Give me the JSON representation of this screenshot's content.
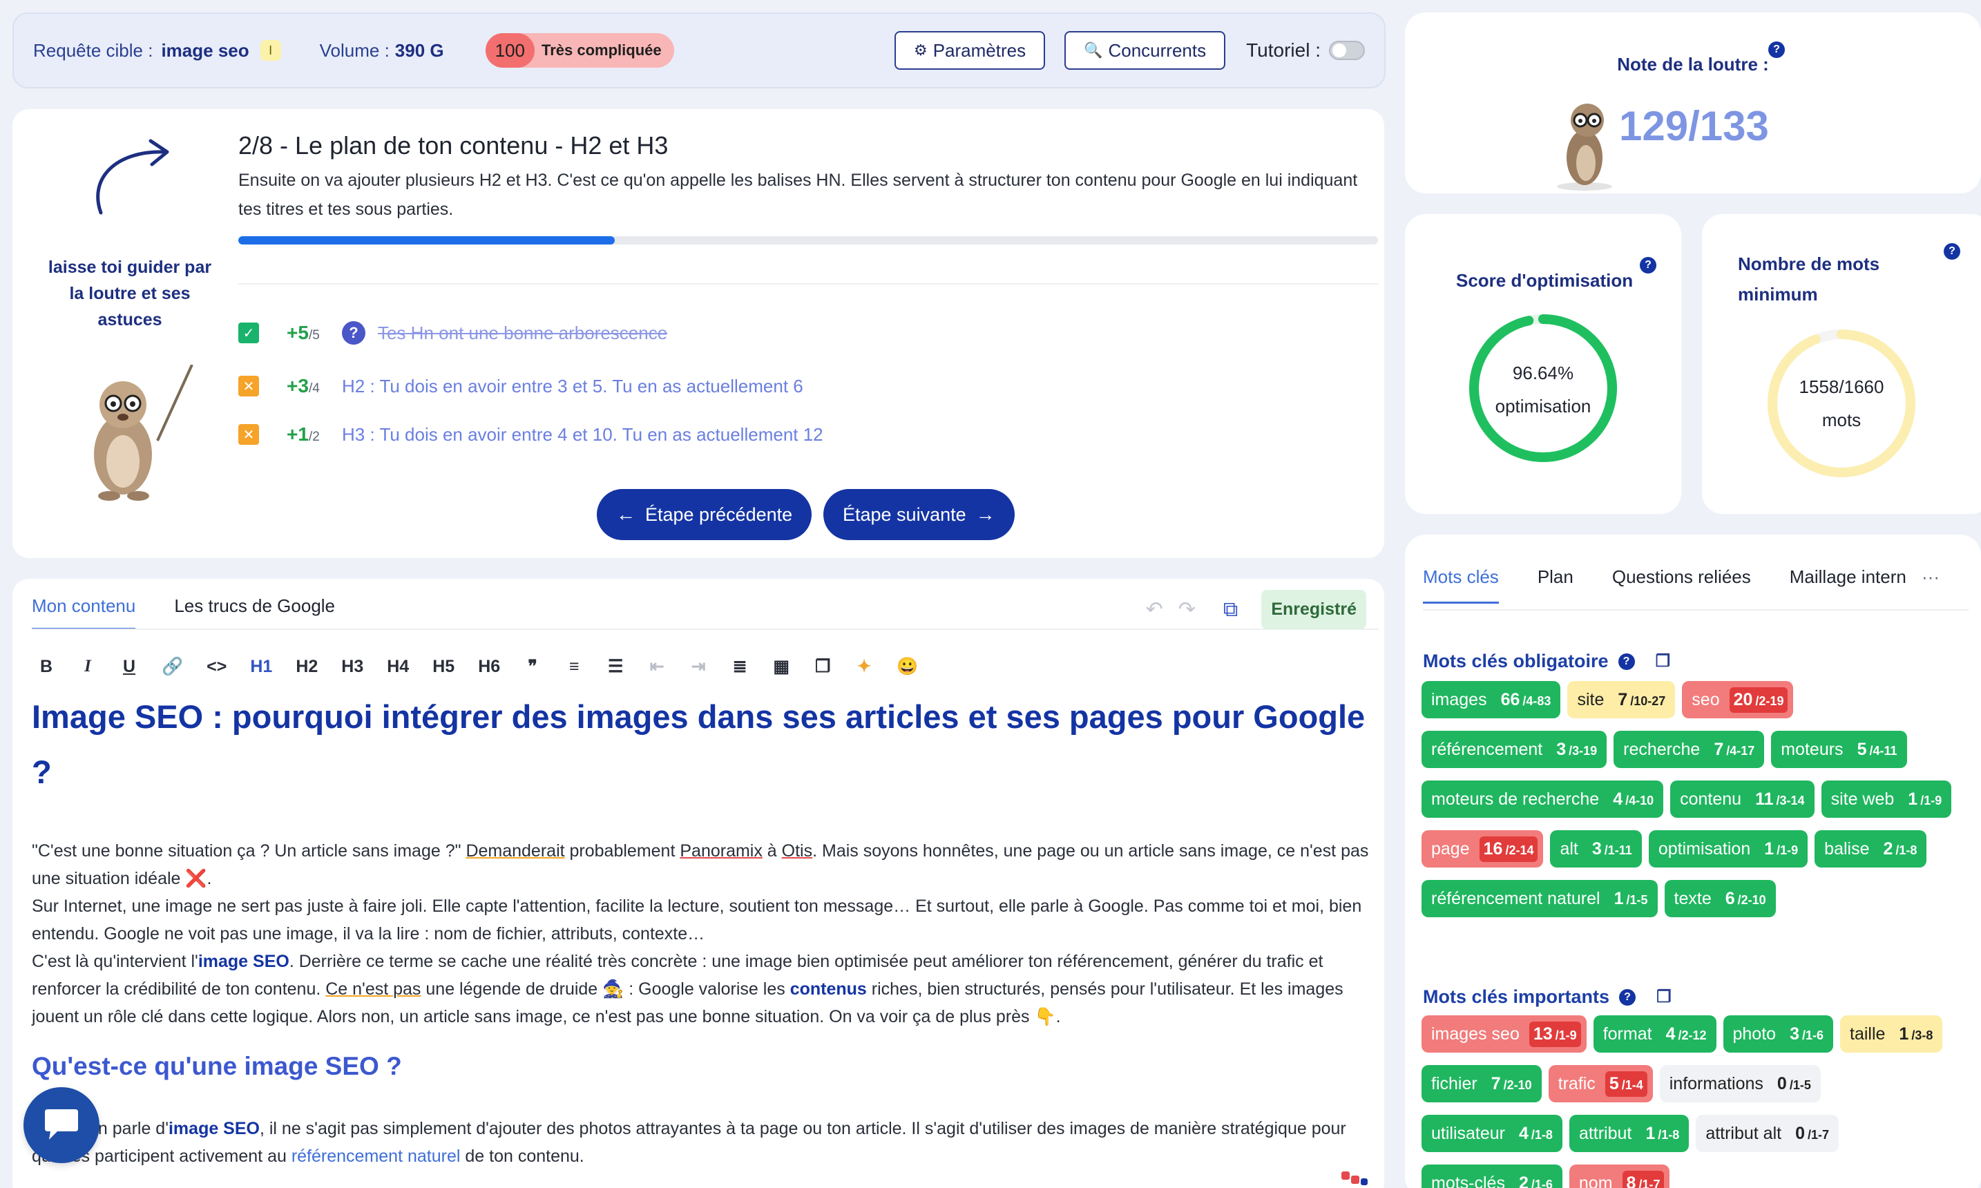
{
  "topbar": {
    "query_label": "Requête cible :",
    "query_value": "image seo",
    "info_icon": "I",
    "volume_label": "Volume :",
    "volume_value": "390 G",
    "difficulty_score": "100",
    "difficulty_label": "Très compliquée",
    "settings_label": "Paramètres",
    "competitors_label": "Concurrents",
    "tutorial_label": "Tutoriel :",
    "tutorial_on": false
  },
  "step": {
    "help_text": "laisse toi guider par la loutre et ses astuces",
    "title": "2/8 - Le plan de ton contenu - H2 et H3",
    "description": "Ensuite on va ajouter plusieurs H2 et H3. C'est ce qu'on appelle les balises HN. Elles servent à structurer ton contenu pour Google en lui indiquant tes titres et tes sous parties.",
    "progress": 0.33,
    "tasks": [
      {
        "points": "+5",
        "max": "/5",
        "text": "Tes Hn ont une bonne arborescence",
        "done": true
      },
      {
        "points": "+3",
        "max": "/4",
        "text": "H2 : Tu dois en avoir entre 3 et 5. Tu en as actuellement 6",
        "done": false
      },
      {
        "points": "+1",
        "max": "/2",
        "text": "H3 : Tu dois en avoir entre 4 et 10. Tu en as actuellement 12",
        "done": false
      }
    ],
    "prev_label": "Étape précédente",
    "next_label": "Étape suivante"
  },
  "editor": {
    "tab_content": "Mon contenu",
    "tab_google": "Les trucs de Google",
    "saved_label": "Enregistré",
    "tools": [
      "B",
      "I",
      "U",
      "🔗",
      "<>",
      "H1",
      "H2",
      "H3",
      "H4",
      "H5",
      "H6",
      "❞",
      "≡",
      "☰",
      "⇤",
      "⇥",
      "≣",
      "▦",
      "❐",
      "✦",
      "😀"
    ],
    "h1": "Image SEO : pourquoi intégrer des images dans ses articles et ses pages pour Google ?",
    "p1_a": "\"C'est une bonne situation ça ? Un article sans image ?\" ",
    "p1_b": "Demanderait",
    "p1_c": " probablement ",
    "p1_d": "Panoramix",
    "p1_e": " à ",
    "p1_f": "Otis",
    "p1_g": ". Mais soyons honnêtes, une page ou un article sans image, ce n'est pas une situation idéale ❌.",
    "p2": "Sur Internet, une image ne sert pas juste à faire joli. Elle capte l'attention, facilite la lecture, soutient ton message… Et surtout, elle parle à Google. Pas comme toi et moi, bien entendu. Google ne voit pas une image, il va la lire : nom de fichier, attributs, contexte…",
    "p3_a": "C'est là qu'intervient l'",
    "p3_b": "image SEO",
    "p3_c": ". Derrière ce terme se cache une réalité très concrète : une image bien optimisée peut améliorer ton référencement, générer du trafic et renforcer la crédibilité de ton contenu. ",
    "p3_d": "Ce n'est pas",
    "p3_e": " une légende de druide 🧙 : Google valorise les ",
    "p3_f": "contenus",
    "p3_g": " riches, bien structurés, pensés pour l'utilisateur. Et les images jouent un rôle clé dans cette logique. Alors non, un article sans image, ce n'est pas une bonne situation. On va voir ça de plus près 👇.",
    "h2": "Qu'est-ce qu'une image SEO ?",
    "p4_a": "Quand on parle d'",
    "p4_b": "image SEO",
    "p4_c": ", il ne s'agit pas simplement d'ajouter des photos attrayantes à ta page ou ton article. Il s'agit d'utiliser des images de manière stratégique pour qu'elles participent activement au ",
    "p4_d": "référencement naturel",
    "p4_e": " de ton contenu."
  },
  "scores": {
    "note_title": "Note de la loutre :",
    "note_value": "129/133",
    "optim_title": "Score d'optimisation",
    "optim_percent": "96.64%",
    "optim_unit": "optimisation",
    "optim_fraction": 0.9664,
    "words_title": "Nombre de mots minimum",
    "words_value": "1558/1660",
    "words_unit": "mots",
    "words_fraction": 0.9386
  },
  "keywords": {
    "tabs": [
      "Mots clés",
      "Plan",
      "Questions reliées",
      "Maillage intern"
    ],
    "more": "···",
    "mandatory_title": "Mots clés obligatoire",
    "important_title": "Mots clés importants",
    "mandatory": [
      {
        "w": "images",
        "c": "66",
        "r": "/4-83",
        "s": "g"
      },
      {
        "w": "site",
        "c": "7",
        "r": "/10-27",
        "s": "y"
      },
      {
        "w": "seo",
        "c": "20",
        "r": "/2-19",
        "s": "r"
      },
      {
        "w": "référencement",
        "c": "3",
        "r": "/3-19",
        "s": "g"
      },
      {
        "w": "recherche",
        "c": "7",
        "r": "/4-17",
        "s": "g"
      },
      {
        "w": "moteurs",
        "c": "5",
        "r": "/4-11",
        "s": "g"
      },
      {
        "w": "moteurs de recherche",
        "c": "4",
        "r": "/4-10",
        "s": "g"
      },
      {
        "w": "contenu",
        "c": "11",
        "r": "/3-14",
        "s": "g"
      },
      {
        "w": "site web",
        "c": "1",
        "r": "/1-9",
        "s": "g"
      },
      {
        "w": "page",
        "c": "16",
        "r": "/2-14",
        "s": "r"
      },
      {
        "w": "alt",
        "c": "3",
        "r": "/1-11",
        "s": "g"
      },
      {
        "w": "optimisation",
        "c": "1",
        "r": "/1-9",
        "s": "g"
      },
      {
        "w": "balise",
        "c": "2",
        "r": "/1-8",
        "s": "g"
      },
      {
        "w": "référencement naturel",
        "c": "1",
        "r": "/1-5",
        "s": "g"
      },
      {
        "w": "texte",
        "c": "6",
        "r": "/2-10",
        "s": "g"
      }
    ],
    "important": [
      {
        "w": "images seo",
        "c": "13",
        "r": "/1-9",
        "s": "r"
      },
      {
        "w": "format",
        "c": "4",
        "r": "/2-12",
        "s": "g"
      },
      {
        "w": "photo",
        "c": "3",
        "r": "/1-6",
        "s": "g"
      },
      {
        "w": "taille",
        "c": "1",
        "r": "/3-8",
        "s": "y"
      },
      {
        "w": "fichier",
        "c": "7",
        "r": "/2-10",
        "s": "g"
      },
      {
        "w": "trafic",
        "c": "5",
        "r": "/1-4",
        "s": "r"
      },
      {
        "w": "informations",
        "c": "0",
        "r": "/1-5",
        "s": "n"
      },
      {
        "w": "utilisateur",
        "c": "4",
        "r": "/1-8",
        "s": "g"
      },
      {
        "w": "attribut",
        "c": "1",
        "r": "/1-8",
        "s": "g"
      },
      {
        "w": "attribut alt",
        "c": "0",
        "r": "/1-7",
        "s": "n"
      },
      {
        "w": "mots-clés",
        "c": "2",
        "r": "/1-6",
        "s": "g"
      },
      {
        "w": "nom",
        "c": "8",
        "r": "/1-7",
        "s": "r"
      }
    ]
  },
  "colors": {
    "primary": "#1434a3",
    "success": "#1fb65f",
    "warning": "#fdeda6",
    "danger": "#f27b7b",
    "gauge_words": "#fbeeb0"
  }
}
